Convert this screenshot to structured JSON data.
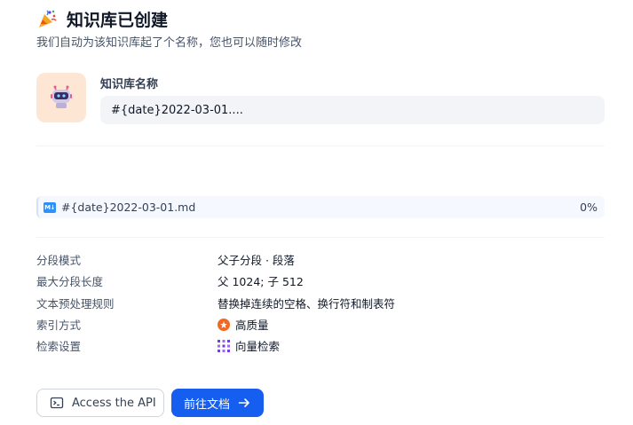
{
  "header": {
    "title": "知识库已创建",
    "subtitle": "我们自动为该知识库起了个名称，您也可以随时修改"
  },
  "knowledge_base": {
    "name_label": "知识库名称",
    "name_value": "#{date}2022-03-01...."
  },
  "file": {
    "name": "#{date}2022-03-01.md",
    "progress": "0%"
  },
  "meta": [
    {
      "label": "分段模式",
      "value": "父子分段 · 段落"
    },
    {
      "label": "最大分段长度",
      "value": "父 1024; 子 512"
    },
    {
      "label": "文本预处理规则",
      "value": "替换掉连续的空格、换行符和制表符"
    },
    {
      "label": "索引方式",
      "value": "高质量",
      "icon": "star-badge-icon"
    },
    {
      "label": "检索设置",
      "value": "向量检索",
      "icon": "vector-grid-icon"
    }
  ],
  "actions": {
    "api_label": "Access the API",
    "docs_label": "前往文档"
  },
  "colors": {
    "primary": "#155eef",
    "avatar_bg": "#fde6d3",
    "quality_orange": "#f06823",
    "vector_purple": "#7839ee"
  }
}
